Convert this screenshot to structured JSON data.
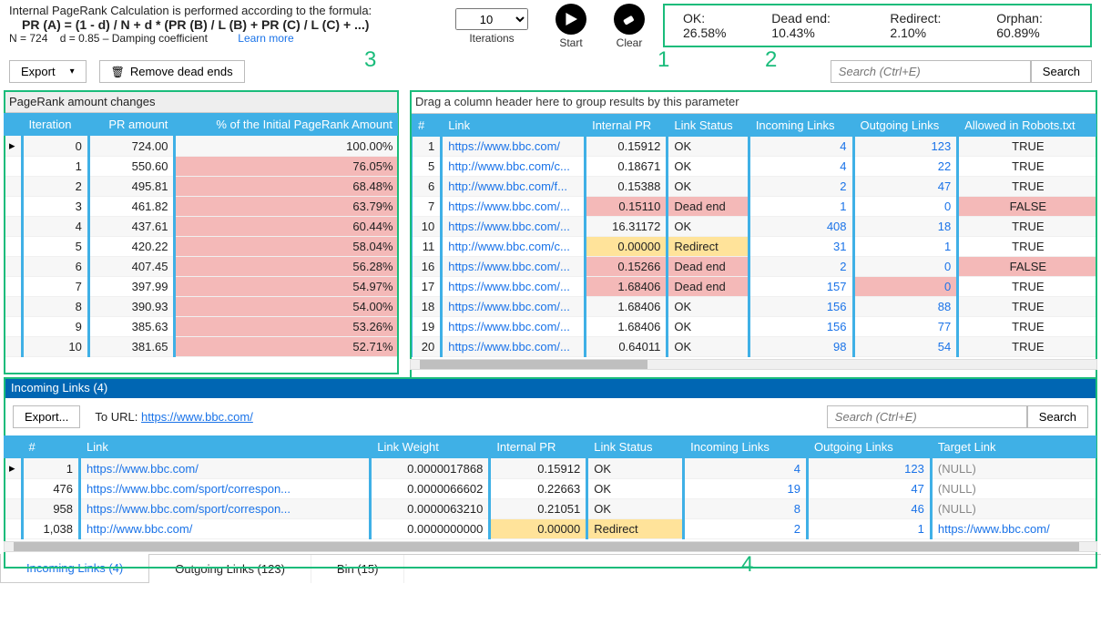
{
  "formula": {
    "line1": "Internal PageRank Calculation is performed according to the formula:",
    "line2": "PR (A) = (1 - d) / N + d * (PR (B) / L (B) + PR (C) / L (C) + ...)",
    "line3_a": "N = 724",
    "line3_b": "d = 0.85 – Damping coefficient",
    "learn": "Learn more"
  },
  "controls": {
    "iterations_value": "10",
    "iterations_label": "Iterations",
    "start_label": "Start",
    "clear_label": "Clear"
  },
  "stats": {
    "ok": "OK: 26.58%",
    "deadend": "Dead end: 10.43%",
    "redirect": "Redirect: 2.10%",
    "orphan": "Orphan: 60.89%"
  },
  "toolbar": {
    "export": "Export",
    "remove_dead": "Remove dead ends",
    "search_ph": "Search (Ctrl+E)",
    "search_btn": "Search"
  },
  "annotations": {
    "a1": "1",
    "a2": "2",
    "a3": "3",
    "a4": "4"
  },
  "left_panel": {
    "title": "PageRank amount changes",
    "cols": [
      "Iteration",
      "PR amount",
      "% of the Initial PageRank Amount"
    ],
    "rows": [
      {
        "it": "0",
        "pr": "724.00",
        "pct": "100.00%",
        "pink": false
      },
      {
        "it": "1",
        "pr": "550.60",
        "pct": "76.05%",
        "pink": true
      },
      {
        "it": "2",
        "pr": "495.81",
        "pct": "68.48%",
        "pink": true
      },
      {
        "it": "3",
        "pr": "461.82",
        "pct": "63.79%",
        "pink": true
      },
      {
        "it": "4",
        "pr": "437.61",
        "pct": "60.44%",
        "pink": true
      },
      {
        "it": "5",
        "pr": "420.22",
        "pct": "58.04%",
        "pink": true
      },
      {
        "it": "6",
        "pr": "407.45",
        "pct": "56.28%",
        "pink": true
      },
      {
        "it": "7",
        "pr": "397.99",
        "pct": "54.97%",
        "pink": true
      },
      {
        "it": "8",
        "pr": "390.93",
        "pct": "54.00%",
        "pink": true
      },
      {
        "it": "9",
        "pr": "385.63",
        "pct": "53.26%",
        "pink": true
      },
      {
        "it": "10",
        "pr": "381.65",
        "pct": "52.71%",
        "pink": true
      }
    ]
  },
  "right_panel": {
    "grouphint": "Drag a column header here to group results by this parameter",
    "cols": [
      "#",
      "Link",
      "Internal PR",
      "Link Status",
      "Incoming Links",
      "Outgoing Links",
      "Allowed in Robots.txt"
    ],
    "rows": [
      {
        "n": "1",
        "link": "https://www.bbc.com/",
        "pr": "0.15912",
        "status": "OK",
        "in": "4",
        "out": "123",
        "rob": "TRUE"
      },
      {
        "n": "5",
        "link": "http://www.bbc.com/c...",
        "pr": "0.18671",
        "status": "OK",
        "in": "4",
        "out": "22",
        "rob": "TRUE"
      },
      {
        "n": "6",
        "link": "http://www.bbc.com/f...",
        "pr": "0.15388",
        "status": "OK",
        "in": "2",
        "out": "47",
        "rob": "TRUE"
      },
      {
        "n": "7",
        "link": "https://www.bbc.com/...",
        "pr": "0.15110",
        "status": "Dead end",
        "in": "1",
        "out": "0",
        "rob": "FALSE",
        "prpink": true,
        "statpink": true,
        "robpink": true
      },
      {
        "n": "10",
        "link": "https://www.bbc.com/...",
        "pr": "16.31172",
        "status": "OK",
        "in": "408",
        "out": "18",
        "rob": "TRUE"
      },
      {
        "n": "11",
        "link": "http://www.bbc.com/c...",
        "pr": "0.00000",
        "status": "Redirect",
        "in": "31",
        "out": "1",
        "rob": "TRUE",
        "pryellow": true,
        "statyellow": true
      },
      {
        "n": "16",
        "link": "https://www.bbc.com/...",
        "pr": "0.15266",
        "status": "Dead end",
        "in": "2",
        "out": "0",
        "rob": "FALSE",
        "prpink": true,
        "statpink": true,
        "robpink": true
      },
      {
        "n": "17",
        "link": "https://www.bbc.com/...",
        "pr": "1.68406",
        "status": "Dead end",
        "in": "157",
        "out": "0",
        "rob": "TRUE",
        "prpink": true,
        "statpink": true,
        "outpink": true
      },
      {
        "n": "18",
        "link": "https://www.bbc.com/...",
        "pr": "1.68406",
        "status": "OK",
        "in": "156",
        "out": "88",
        "rob": "TRUE"
      },
      {
        "n": "19",
        "link": "https://www.bbc.com/...",
        "pr": "1.68406",
        "status": "OK",
        "in": "156",
        "out": "77",
        "rob": "TRUE"
      },
      {
        "n": "20",
        "link": "https://www.bbc.com/...",
        "pr": "0.64011",
        "status": "OK",
        "in": "98",
        "out": "54",
        "rob": "TRUE"
      }
    ]
  },
  "bottom": {
    "title": "Incoming Links (4)",
    "export": "Export...",
    "tourl_label": "To URL:",
    "tourl_link": "https://www.bbc.com/",
    "search_ph": "Search (Ctrl+E)",
    "search_btn": "Search",
    "cols": [
      "#",
      "Link",
      "Link Weight",
      "Internal PR",
      "Link Status",
      "Incoming Links",
      "Outgoing Links",
      "Target Link"
    ],
    "rows": [
      {
        "n": "1",
        "link": "https://www.bbc.com/",
        "w": "0.0000017868",
        "pr": "0.15912",
        "status": "OK",
        "in": "4",
        "out": "123",
        "tgt": "(NULL)"
      },
      {
        "n": "476",
        "link": "https://www.bbc.com/sport/correspon...",
        "w": "0.0000066602",
        "pr": "0.22663",
        "status": "OK",
        "in": "19",
        "out": "47",
        "tgt": "(NULL)"
      },
      {
        "n": "958",
        "link": "https://www.bbc.com/sport/correspon...",
        "w": "0.0000063210",
        "pr": "0.21051",
        "status": "OK",
        "in": "8",
        "out": "46",
        "tgt": "(NULL)"
      },
      {
        "n": "1,038",
        "link": "http://www.bbc.com/",
        "w": "0.0000000000",
        "pr": "0.00000",
        "status": "Redirect",
        "in": "2",
        "out": "1",
        "tgt": "https://www.bbc.com/",
        "pryellow": true,
        "statyellow": true,
        "tgtlink": true
      }
    ]
  },
  "tabs": {
    "t1": "Incoming Links (4)",
    "t2": "Outgoing Links (123)",
    "t3": "Bin (15)"
  }
}
